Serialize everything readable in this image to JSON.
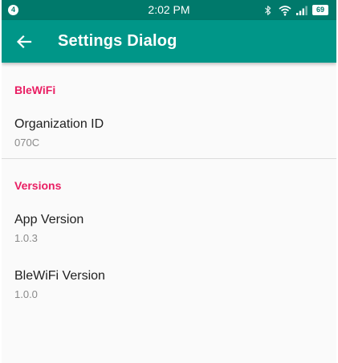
{
  "status_bar": {
    "notification_count": "4",
    "time": "2:02 PM",
    "battery": "69",
    "icons": [
      "bluetooth-icon",
      "wifi-icon",
      "signal-icon",
      "battery-icon"
    ]
  },
  "app_bar": {
    "title": "Settings Dialog",
    "back_icon": "arrow-back-icon"
  },
  "sections": [
    {
      "header": "BleWiFi",
      "items": [
        {
          "title": "Organization ID",
          "summary": "070C"
        }
      ]
    },
    {
      "header": "Versions",
      "items": [
        {
          "title": "App Version",
          "summary": "1.0.3"
        },
        {
          "title": "BleWiFi Version",
          "summary": "1.0.0"
        }
      ]
    }
  ],
  "colors": {
    "primary": "#009688",
    "primary_dark": "#00796b",
    "accent": "#e91e63",
    "background": "#fafafa"
  }
}
